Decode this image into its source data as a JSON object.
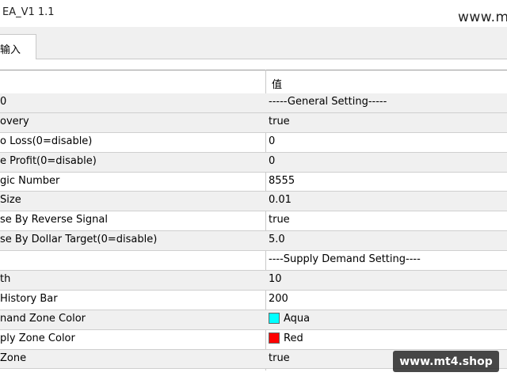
{
  "window": {
    "title": "EA_V1 1.1",
    "watermark_top": "www.m"
  },
  "tabs": [
    {
      "label": "输入"
    }
  ],
  "table": {
    "header_value": "值",
    "rows": [
      {
        "name": "0",
        "value": "-----General Setting-----"
      },
      {
        "name": "overy",
        "value": "true"
      },
      {
        "name": "o Loss(0=disable)",
        "value": "0"
      },
      {
        "name": "e Profit(0=disable)",
        "value": "0"
      },
      {
        "name": "gic Number",
        "value": "8555"
      },
      {
        "name": "Size",
        "value": "0.01"
      },
      {
        "name": "se By Reverse Signal",
        "value": "true"
      },
      {
        "name": "se By Dollar Target(0=disable)",
        "value": "5.0"
      },
      {
        "name": "",
        "value": "----Supply Demand Setting----"
      },
      {
        "name": "th",
        "value": "10"
      },
      {
        "name": "History Bar",
        "value": "200"
      },
      {
        "name": "nand Zone Color",
        "value": "Aqua",
        "swatch": "#00ffff"
      },
      {
        "name": "ply Zone Color",
        "value": "Red",
        "swatch": "#ff0000"
      },
      {
        "name": "Zone",
        "value": "true"
      }
    ]
  },
  "watermark_badge": "www.mt4.shop",
  "colors": {
    "alt_row": "#f0f0f0",
    "aqua": "#00ffff",
    "red": "#ff0000"
  }
}
